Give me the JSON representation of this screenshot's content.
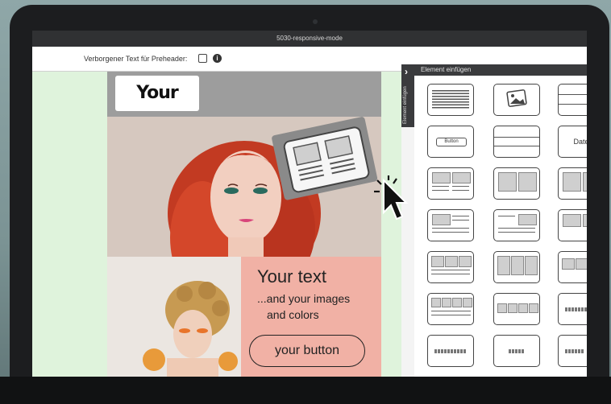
{
  "window": {
    "title": "5030-responsive-mode"
  },
  "toolbar": {
    "preheader_label": "Verborgener Text für Preheader:",
    "info_glyph": "i"
  },
  "template": {
    "logo_text": "Your logo",
    "heading": "Your text",
    "subline1": "...and your images",
    "subline2": "and colors",
    "button_label": "your button"
  },
  "panel": {
    "header": "Element einfügen",
    "tab_label": "Element einfügen",
    "tab_chevron": "›",
    "tiles": [
      {
        "id": "text-block",
        "label": ""
      },
      {
        "id": "image",
        "label": ""
      },
      {
        "id": "divider",
        "label": ""
      },
      {
        "id": "button",
        "label": "Button"
      },
      {
        "id": "spacer",
        "label": ""
      },
      {
        "id": "date",
        "label": "Date"
      }
    ]
  },
  "colors": {
    "canvas_bg": "#dff3dc",
    "accent_pink": "#f1b1a5",
    "panel_dark": "#3a3b3d"
  }
}
